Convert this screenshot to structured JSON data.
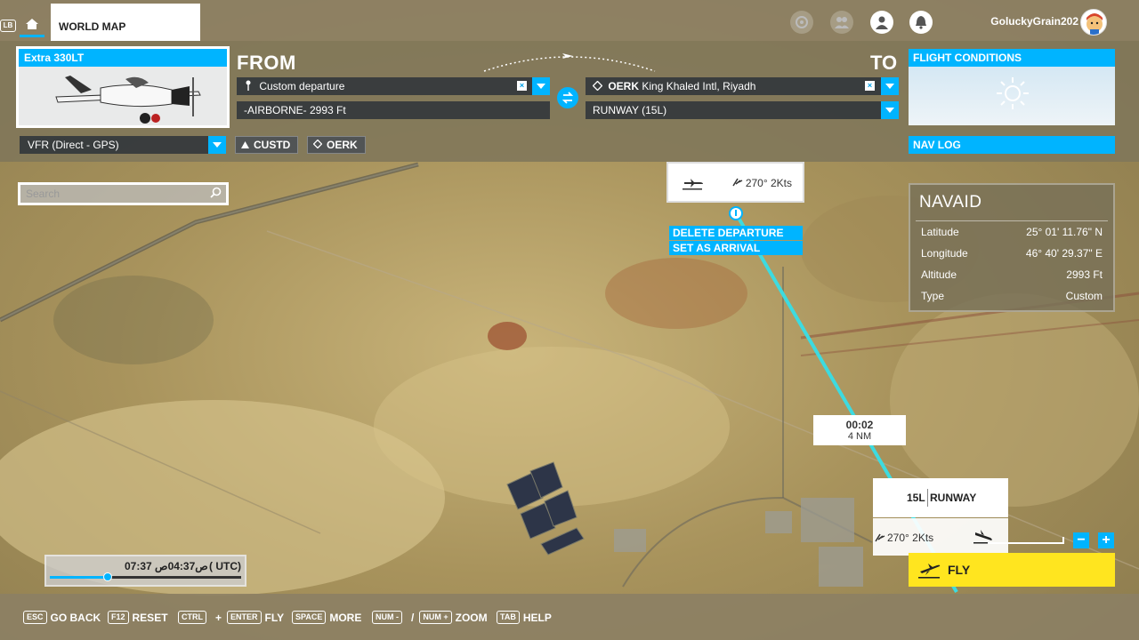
{
  "topbar": {
    "lb_label": "LB",
    "world_map_tab": "WORLD MAP",
    "username": "GoluckyGrain202"
  },
  "aircraft": {
    "name": "Extra 330LT"
  },
  "from": {
    "title": "FROM",
    "departure": "Custom departure",
    "altitude": "-AIRBORNE- 2993 Ft"
  },
  "to": {
    "title": "TO",
    "airport_code": "OERK",
    "airport_name": "King Khaled Intl, Riyadh",
    "runway": "RUNWAY (15L)"
  },
  "conditions": {
    "label": "FLIGHT CONDITIONS"
  },
  "nav": {
    "flight_type": "VFR (Direct - GPS)",
    "waypoint_from": "CUSTD",
    "waypoint_to": "OERK",
    "navlog_label": "NAV LOG"
  },
  "search": {
    "placeholder": "Search"
  },
  "waypoint_card": {
    "wind": "270° 2Kts",
    "menu": [
      "DELETE DEPARTURE",
      "SET AS ARRIVAL"
    ]
  },
  "navaid": {
    "title": "NAVAID",
    "rows": [
      {
        "label": "Latitude",
        "value": "25° 01' 11.76\" N"
      },
      {
        "label": "Longitude",
        "value": "46° 40' 29.37\" E"
      },
      {
        "label": "Altitude",
        "value": "2993 Ft"
      },
      {
        "label": "Type",
        "value": "Custom"
      }
    ]
  },
  "leg": {
    "time": "00:02",
    "distance": "4 NM"
  },
  "runway_card": {
    "number": "15L",
    "label": "RUNWAY",
    "wind": "270° 2Kts"
  },
  "zoom": {
    "minus": "−",
    "plus": "+"
  },
  "fly": {
    "label": "FLY"
  },
  "time": {
    "local": "07:37",
    "utc_display": "ص04:37ص",
    "utc_label": "( UTC)",
    "slider_fraction": 0.3
  },
  "hotkeys": [
    {
      "keys": [
        "ESC"
      ],
      "label": "GO BACK"
    },
    {
      "keys": [
        "F12"
      ],
      "label": "RESET"
    },
    {
      "keys": [
        "CTRL",
        "ENTER"
      ],
      "label": "FLY"
    },
    {
      "keys": [
        "SPACE"
      ],
      "label": "MORE"
    },
    {
      "keys": [
        "NUM -",
        "NUM +"
      ],
      "label": "ZOOM"
    },
    {
      "keys": [
        "TAB"
      ],
      "label": "HELP"
    }
  ],
  "colors": {
    "accent": "#00b4ff",
    "fly_button": "#ffe51f",
    "route_line": "#3ddbe0"
  }
}
